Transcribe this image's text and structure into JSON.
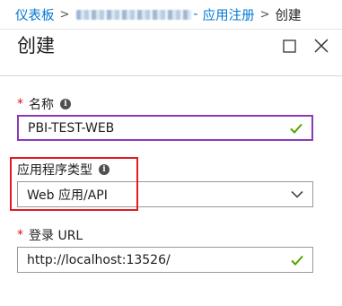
{
  "breadcrumb": {
    "items": [
      "仪表板",
      "应用注册",
      "创建"
    ],
    "separator": ">"
  },
  "header": {
    "title": "创建",
    "maximize_icon": "maximize-icon",
    "close_icon": "close-icon"
  },
  "form": {
    "name": {
      "label": "名称",
      "required_mark": "*",
      "info_glyph": "i",
      "value": "PBI-TEST-WEB",
      "valid": true
    },
    "app_type": {
      "label": "应用程序类型",
      "info_glyph": "i",
      "value": "Web 应用/API"
    },
    "sign_on_url": {
      "label": "登录 URL",
      "required_mark": "*",
      "value": "http://localhost:13526/",
      "valid": true
    }
  },
  "colors": {
    "accent": "#0078d4",
    "focus_border": "#8a3ab9",
    "valid_check": "#57a300",
    "required": "#e00b1c",
    "highlight": "#e31b23"
  }
}
